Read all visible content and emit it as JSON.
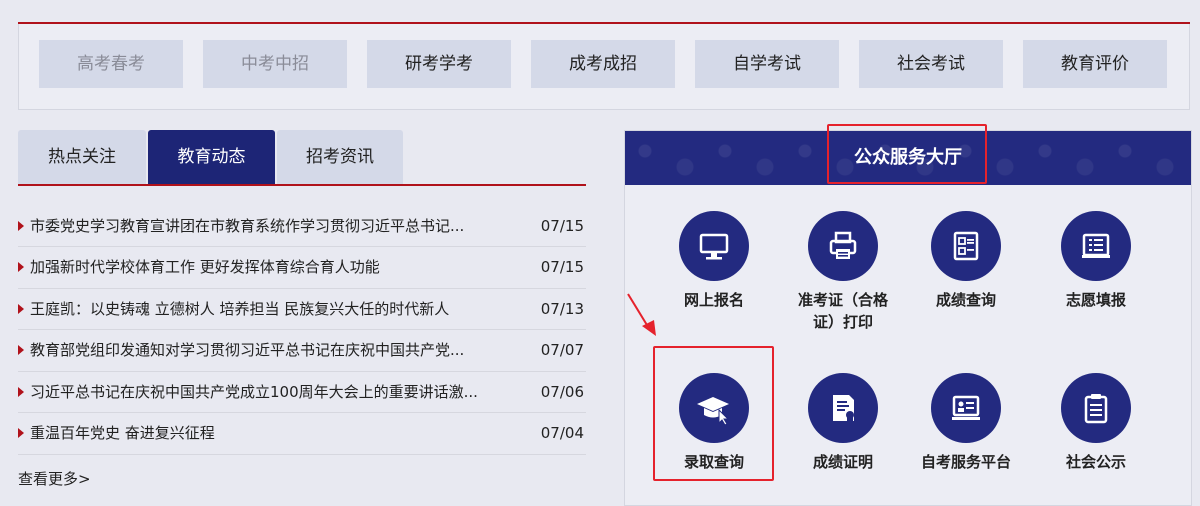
{
  "categories": [
    "高考春考",
    "中考中招",
    "研考学考",
    "成考成招",
    "自学考试",
    "社会考试",
    "教育评价"
  ],
  "tabs": [
    "热点关注",
    "教育动态",
    "招考资讯"
  ],
  "news": [
    {
      "title": "市委党史学习教育宣讲团在市教育系统作学习贯彻习近平总书记...",
      "date": "07/15"
    },
    {
      "title": "加强新时代学校体育工作 更好发挥体育综合育人功能",
      "date": "07/15"
    },
    {
      "title": "王庭凯：以史铸魂 立德树人 培养担当 民族复兴大任的时代新人",
      "date": "07/13"
    },
    {
      "title": "教育部党组印发通知对学习贯彻习近平总书记在庆祝中国共产党...",
      "date": "07/07"
    },
    {
      "title": "习近平总书记在庆祝中国共产党成立100周年大会上的重要讲话激...",
      "date": "07/06"
    },
    {
      "title": "重温百年党史 奋进复兴征程",
      "date": "07/04"
    }
  ],
  "more": "查看更多>",
  "hall": {
    "title": "公众服务大厅",
    "services": [
      {
        "label": "网上报名",
        "icon": "monitor-icon"
      },
      {
        "label": "准考证（合格证）打印",
        "icon": "printer-icon"
      },
      {
        "label": "成绩查询",
        "icon": "score-query-icon"
      },
      {
        "label": "志愿填报",
        "icon": "form-icon"
      },
      {
        "label": "录取查询",
        "icon": "graduation-cap-icon"
      },
      {
        "label": "成绩证明",
        "icon": "certificate-icon"
      },
      {
        "label": "自考服务平台",
        "icon": "platform-icon"
      },
      {
        "label": "社会公示",
        "icon": "clipboard-icon"
      }
    ]
  },
  "colors": {
    "accent": "#b0121b",
    "navy": "#232a80",
    "highlight": "#e5222c"
  }
}
